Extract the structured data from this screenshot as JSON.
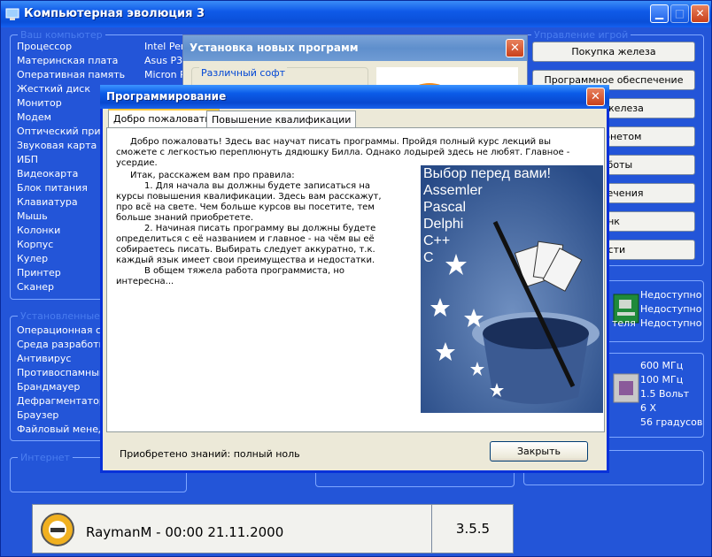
{
  "window": {
    "title": "Компьютерная эволюция 3"
  },
  "left_panel": {
    "computer_group": "Ваш компьютер",
    "hardware_labels": [
      "Процессор",
      "Материнская плата",
      "Оперативная память",
      "Жесткий диск",
      "Монитор",
      "Модем",
      "Оптический приво",
      "Звуковая карта",
      "ИБП",
      "Видеокарта",
      "Блок питания",
      "Клавиатура",
      "Мышь",
      "Колонки",
      "Корпус",
      "Кулер",
      "Принтер",
      "Сканер"
    ],
    "hardware_values": [
      "Intel Per",
      "Asus P3E",
      "Micron P"
    ],
    "installed_group": "Установленные пр",
    "software_labels": [
      "Операционная си",
      "Среда разработки",
      "Антивирус",
      "Противоспамный",
      "Брандмауер",
      "Дефрагментатор р",
      "Браузер",
      "Файловый менедж"
    ],
    "internet_group": "Интернет"
  },
  "right_panel": {
    "group": "Управление игрой",
    "buttons": [
      "Покупка железа",
      "Программное обеспечение",
      "ние железа",
      "нтернетом",
      "работы",
      "азвлечения",
      "нк",
      "ости"
    ],
    "status_values": [
      "Недоступно",
      "Недоступно",
      "Недоступно"
    ],
    "status_label_fragment": "теля",
    "specs": [
      "600 МГц",
      "100 МГц",
      "1.5 Вольт",
      "6 X",
      "56 градусов"
    ]
  },
  "bg_dialog": {
    "title": "Установка новых программ",
    "group_label": "Различный софт"
  },
  "dialog": {
    "title": "Программирование",
    "tabs": [
      "Добро пожаловать!",
      "Повышение квалификации"
    ],
    "welcome": "Добро пожаловать! Здесь вас научат писать программы. Пройдя полный курс лекций вы сможете с легкостью переплюнуть дядюшку Билла. Однако лодырей здесь не любят. Главное - усердие.",
    "rules": [
      "Итак, расскажем вам про правила:",
      "1. Для начала вы должны будете записаться на курсы повышения квалификации. Здесь вам расскажут, про всё на свете. Чем больше курсов вы посетите, тем больше знаний приобретете.",
      "2. Начиная писать программу вы должны будете определиться с её названием и главное - на чём вы её собираетесь писать. Выбирать следует аккуратно, т.к. каждый язык имеет свои преимущества и недостатки.",
      "В общем тяжела работа программиста, но интересна..."
    ],
    "promo_lines": [
      "Выбор перед вами!",
      "Assemler",
      "Pascal",
      "Delphi",
      "C++",
      "C"
    ],
    "knowledge": "Приобретено знаний: полный ноль",
    "close_button": "Закрыть"
  },
  "status_bar": {
    "user": "RaymanM - 00:00 21.11.2000",
    "version": "3.5.5"
  },
  "colors": {
    "window_bg": "#2355d8",
    "titlebar": "#0a4fd8",
    "dialog_face": "#ece9d8"
  }
}
